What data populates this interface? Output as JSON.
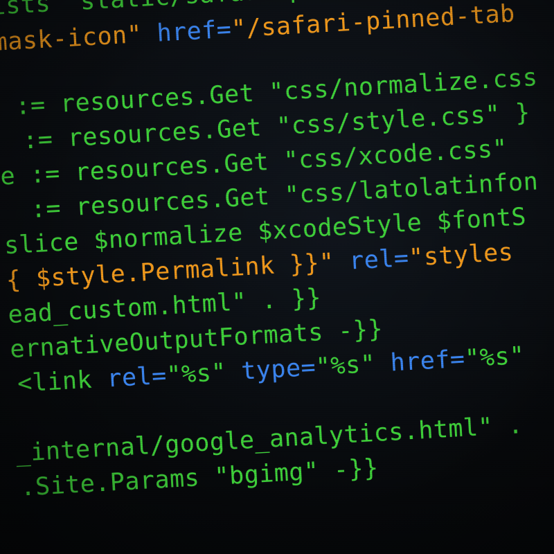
{
  "colors": {
    "green": "#3fd23a",
    "orange": "#f29a1c",
    "blue": "#3b86f2",
    "white": "#e8e8e8",
    "background": "#07090c"
  },
  "code_lines": [
    [
      {
        "t": "ists \"static/safari-pinned-tab.svg\"",
        "c": "g"
      }
    ],
    [
      {
        "t": "mask-icon\" ",
        "c": "o"
      },
      {
        "t": "href=",
        "c": "b"
      },
      {
        "t": "\"/safari-pinned-tab",
        "c": "o"
      }
    ],
    [],
    [
      {
        "t": " := resources.Get ",
        "c": "g"
      },
      {
        "t": "\"css/normalize.css",
        "c": "g"
      }
    ],
    [
      {
        "t": " := resources.Get ",
        "c": "g"
      },
      {
        "t": "\"css/style.css\" }",
        "c": "g"
      }
    ],
    [
      {
        "t": "e := resources.Get ",
        "c": "g"
      },
      {
        "t": "\"css/xcode.css\"",
        "c": "g"
      }
    ],
    [
      {
        "t": " := resources.Get ",
        "c": "g"
      },
      {
        "t": "\"css/latolatinfon",
        "c": "g"
      }
    ],
    [
      {
        "t": "slice $normalize $xcodeStyle $fontS",
        "c": "g"
      }
    ],
    [
      {
        "t": "{ $style.Permalink }}\" ",
        "c": "o"
      },
      {
        "t": "rel=",
        "c": "b"
      },
      {
        "t": "\"styles",
        "c": "o"
      }
    ],
    [
      {
        "t": "ead_custom.html\" . }}",
        "c": "g"
      }
    ],
    [
      {
        "t": "ernativeOutputFormats -}}",
        "c": "g"
      }
    ],
    [
      {
        "t": "<link ",
        "c": "g"
      },
      {
        "t": "rel=",
        "c": "b"
      },
      {
        "t": "\"%s\" ",
        "c": "g"
      },
      {
        "t": "type=",
        "c": "b"
      },
      {
        "t": "\"%s\" ",
        "c": "g"
      },
      {
        "t": "href=",
        "c": "b"
      },
      {
        "t": "\"%s\"",
        "c": "g"
      }
    ],
    [],
    [
      {
        "t": "_internal/google_analytics.html\" .",
        "c": "g"
      }
    ],
    [
      {
        "t": ".Site.Params \"bgimg\" -}}",
        "c": "g"
      }
    ]
  ]
}
